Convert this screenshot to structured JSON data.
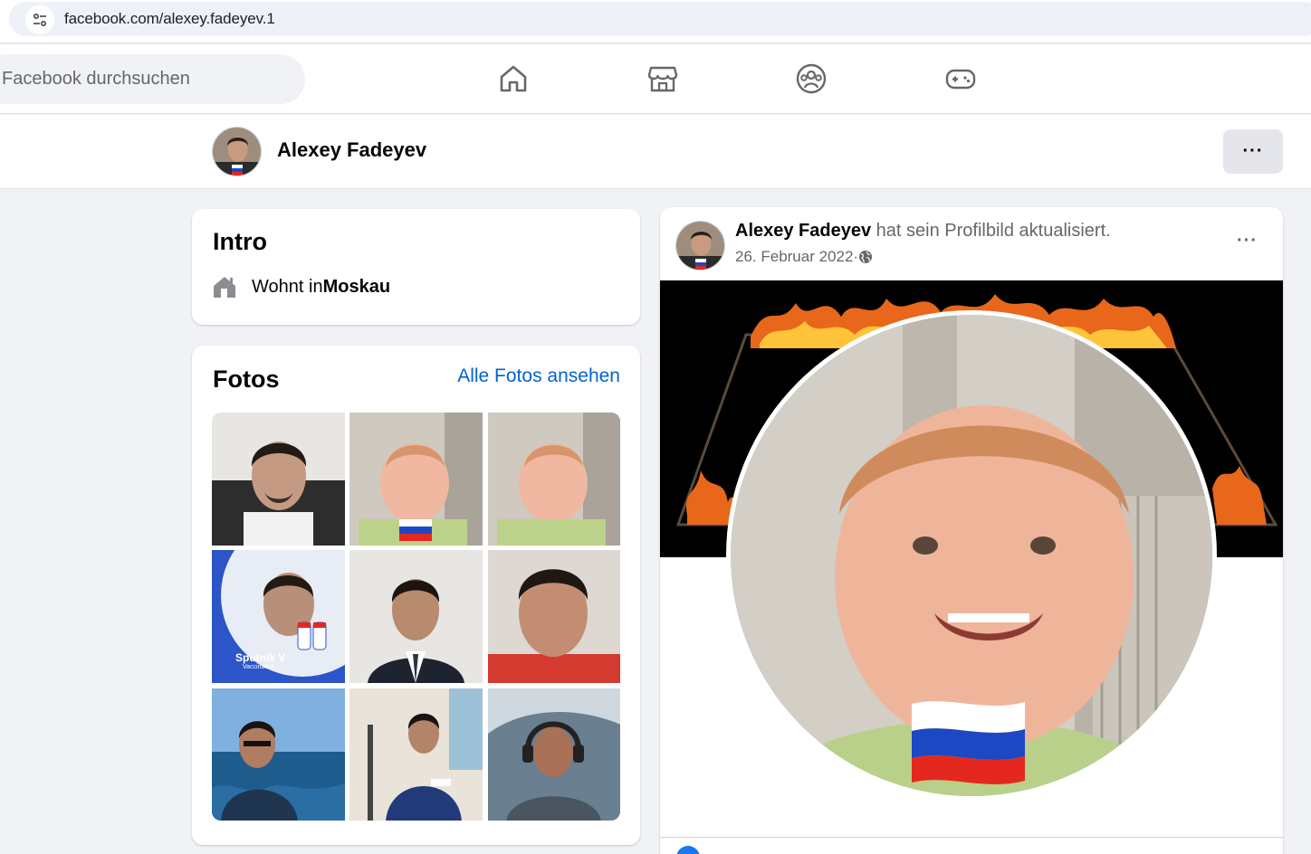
{
  "browser": {
    "url": "facebook.com/alexey.fadeyev.1"
  },
  "header": {
    "search_placeholder": "Facebook durchsuchen",
    "nav_icons": [
      "home-icon",
      "marketplace-icon",
      "groups-icon",
      "gaming-icon"
    ]
  },
  "profile": {
    "name": "Alexey Fadeyev",
    "more_label": "···"
  },
  "intro": {
    "title": "Intro",
    "lives_prefix": "Wohnt in ",
    "lives_city": "Moskau"
  },
  "photos": {
    "title": "Fotos",
    "see_all": "Alle Fotos ansehen",
    "sputnik_title": "Sputnik V",
    "sputnik_sub": "Vaccinated"
  },
  "post": {
    "author": "Alexey Fadeyev",
    "action": " hat sein Profilbild aktualisiert.",
    "date": "26. Februar 2022",
    "sep": " · ",
    "more_label": "···"
  },
  "colors": {
    "brand_blue": "#1877f2",
    "link_blue": "#0064d1",
    "flag_white": "#ffffff",
    "flag_blue": "#1c48c4",
    "flag_red": "#e5281f"
  }
}
